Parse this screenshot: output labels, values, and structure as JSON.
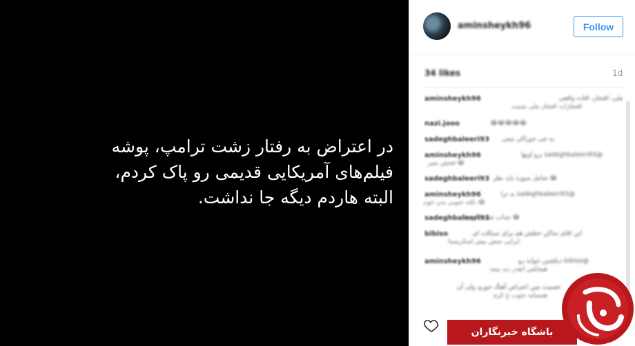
{
  "post": {
    "lines": [
      "در اعتراض به رفتار زشت ترامپ، پوشه",
      "فیلم‌های آمریکایی قدیمی رو پاک کردم،",
      "البته هاردم دیگه جا نداشت."
    ]
  },
  "header": {
    "username": "aminsheykh96",
    "follow_label": "Follow"
  },
  "stats": {
    "likes": "34 likes",
    "time": "1d"
  },
  "comments": [
    {
      "user": "aminsheykh96",
      "text": "ملی، افتخار، افاده واقعی",
      "line2": "افتخارات افتخار ملی نسبت"
    },
    {
      "user": "nazi.jooo",
      "text": "😂😂😂😂😂",
      "line2": ""
    },
    {
      "user": "sadeghbaleeri93",
      "text": "به چی خوراکی نیمی",
      "line2": ""
    },
    {
      "user": "aminsheykh96",
      "text": "@sadeghbaleeri93 برو اونها",
      "line2": "😂 فحش نمیر"
    },
    {
      "user": "sadeghbaleeri93",
      "text": "😂 شامل سوژه باید نظر",
      "line2": ""
    },
    {
      "user": "aminsheykh96",
      "text": "@sadeghbaleeri93 به ترا",
      "line2": "😂 نکته جنوبی بدن خوب"
    },
    {
      "user": "sadeghbaleeri93",
      "text": "😂 جذاب شده اکو ددا",
      "line2": ""
    },
    {
      "user": "bibiso",
      "text": "این اقای ساکن خطش هم برای سیکلت ای",
      "line2": "ایرانی جنش بیش اسکریستا"
    },
    {
      "user": "aminsheykh96",
      "text": "@bibiso دیکشین جوابه رو",
      "line2": "هیچکس انقدر دید نیمه"
    },
    {
      "user": "",
      "text": "عصبیت مین اعتراض آهنگ جوری ولی آن",
      "line2": "همسایه جنوب ع کرم"
    }
  ],
  "brand": {
    "name": "باشگاه خبرنگاران",
    "color": "#b8171b"
  },
  "icons": {
    "like": "heart-outline-icon",
    "logo": "ybc-logo-icon"
  }
}
